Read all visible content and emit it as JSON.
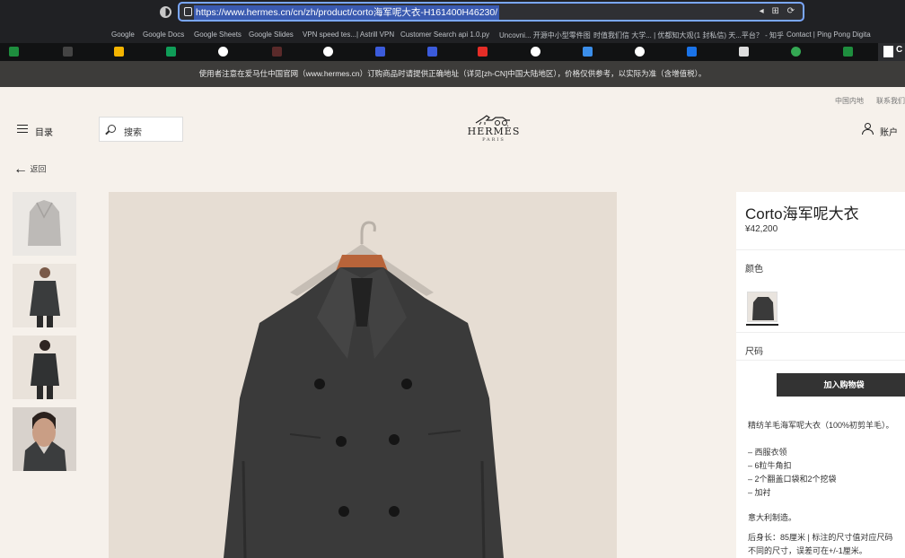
{
  "browser": {
    "url": "https://www.hermes.cn/cn/zh/product/corto海军呢大衣-H161400H46230/",
    "url_icons": "◂ ⊞ ⟳",
    "bookmarks": [
      "Google",
      "Google Docs",
      "Google Sheets",
      "Google Slides",
      "VPN speed tes...| Astrill VPN",
      "Customer Search api 1.0.py",
      "Uncovni... 开源中小型零件图",
      "时值我们信 大学... | 优都知大观",
      "(1 封私信) 天...平台？ - 知乎",
      "Contact | Ping Pong Digita"
    ],
    "active_tab_char": "C"
  },
  "notice": "使用者注意在爱马仕中国官网（www.hermes.cn）订购商品时请提供正确地址（详见[zh-CN]中国大陆地区），价格仅供参考，以实际为准（含增值税）。",
  "header": {
    "top_right": [
      "中国内地",
      "联系我们"
    ],
    "menu_label": "目录",
    "search_label": "搜索",
    "logo_name": "HERMÈS",
    "logo_city": "PARIS",
    "account_label": "账户"
  },
  "back_label": "返回",
  "product": {
    "title": "Corto海军呢大衣",
    "price": "¥42,200",
    "color_label": "颜色",
    "size_label": "尺码",
    "add_to_cart": "加入购物袋",
    "description": [
      "精纺羊毛海军呢大衣（100%初剪羊毛）。",
      "",
      "– 西服衣领",
      "– 6粒牛角扣",
      "– 2个翻盖口袋和2个挖袋",
      "– 加衬",
      "",
      "意大利制造。",
      "",
      "后身长：85厘米 | 标注的尺寸值对应尺码",
      "不同的尺寸，误差可在+/-1厘米。"
    ]
  },
  "colors": {
    "coat": "#3a3a3a",
    "hanger_tag": "#b8643a",
    "cart_button": "#333333",
    "notice_bar": "#3d3c3a"
  }
}
